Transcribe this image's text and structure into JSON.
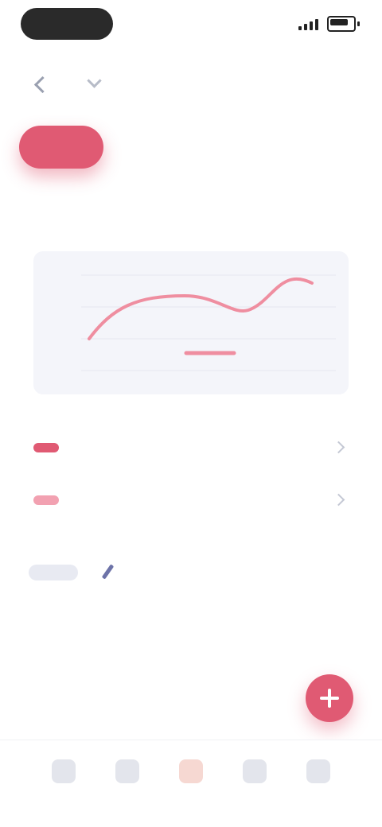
{
  "header": {
    "title": ""
  },
  "tabs": [
    {
      "label": ""
    },
    {
      "label": ""
    },
    {
      "label": ""
    },
    {
      "label": ""
    }
  ],
  "chart": {
    "title": "",
    "y_ticks": [
      "",
      "",
      "",
      ""
    ]
  },
  "legend": [
    {
      "label": ""
    },
    {
      "label": ""
    }
  ],
  "info": {
    "pill": "",
    "value": ""
  },
  "tabbar": [
    {
      "label": ""
    },
    {
      "label": ""
    },
    {
      "label": ""
    },
    {
      "label": ""
    },
    {
      "label": ""
    }
  ],
  "colors": {
    "accent": "#e05a73",
    "title": "#2c3350",
    "muted": "#8d93a5"
  }
}
